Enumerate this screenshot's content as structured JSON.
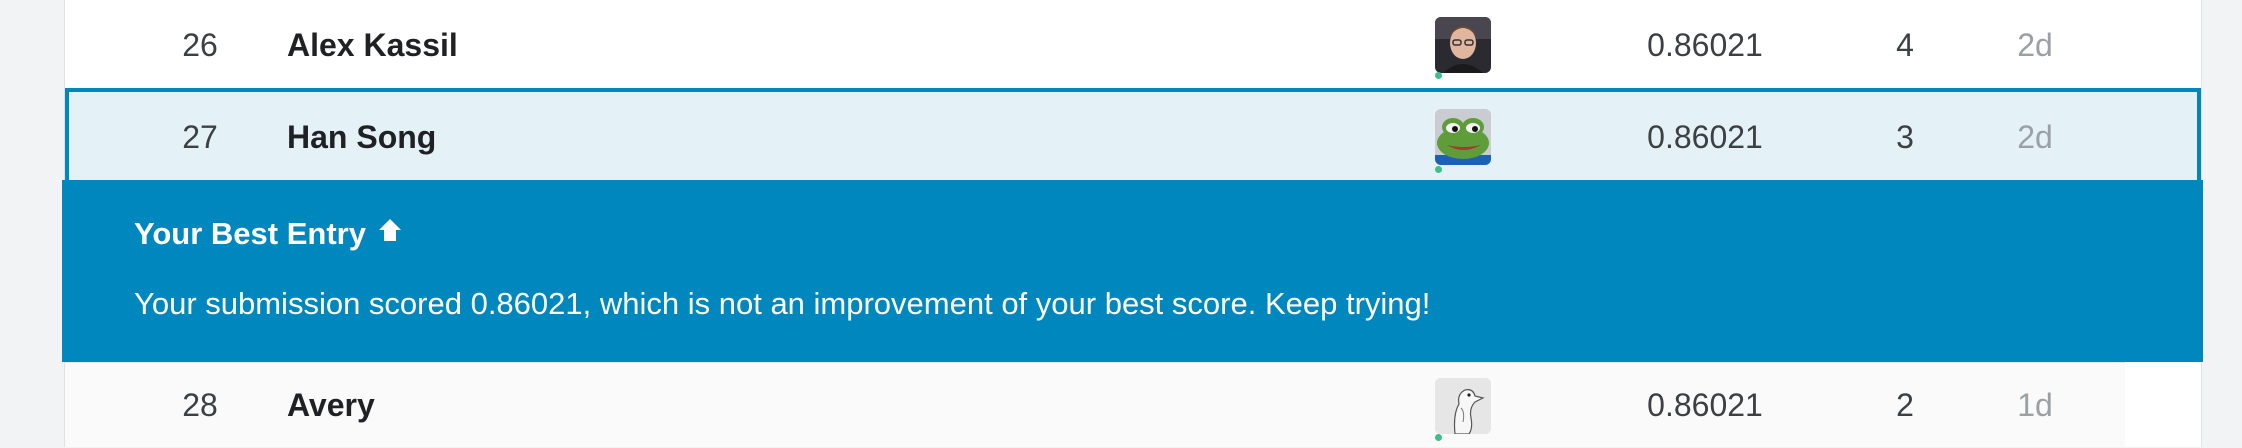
{
  "rows": [
    {
      "rank": "26",
      "name": "Alex Kassil",
      "avatar": "person-avatar",
      "score": "0.86021",
      "entries": "4",
      "last": "2d"
    },
    {
      "rank": "27",
      "name": "Han Song",
      "avatar": "frog-avatar",
      "score": "0.86021",
      "entries": "3",
      "last": "2d"
    },
    {
      "rank": "28",
      "name": "Avery",
      "avatar": "goose-avatar",
      "score": "0.86021",
      "entries": "2",
      "last": "1d"
    }
  ],
  "banner": {
    "title": "Your Best Entry",
    "icon": "arrow-up-icon",
    "message": "Your submission scored 0.86021, which is not an improvement of your best score. Keep trying!"
  },
  "colors": {
    "accent": "#0088be",
    "highlight_row": "#e4f1f7",
    "online_dot": "#3bc08a"
  }
}
